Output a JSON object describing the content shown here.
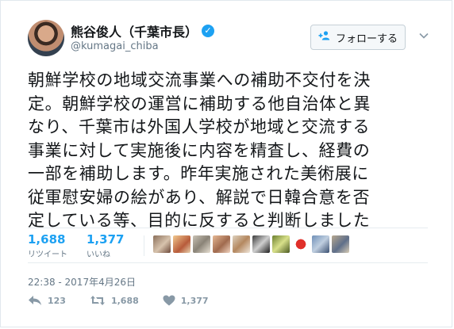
{
  "author": {
    "name": "熊谷俊人（千葉市長）",
    "handle": "@kumagai_chiba"
  },
  "follow_button": {
    "label": "フォローする",
    "icon": "add-user-icon"
  },
  "tweet": {
    "lines": [
      "朝鮮学校の地域交流事業への補助不交付を決",
      "定。朝鮮学校の運営に補助する他自治体と異",
      "なり、千葉市は外国人学校が地域と交流する",
      "事業に対して実施後に内容を精査し、経費の",
      "一部を補助します。昨年実施された美術展に",
      "従軍慰安婦の絵があり、解説で日韓合意を否",
      "定している等、目的に反すると判断しました"
    ]
  },
  "stats": {
    "retweets": {
      "count": "1,688",
      "label": "リツイート"
    },
    "likes": {
      "count": "1,377",
      "label": "いいね"
    }
  },
  "timestamp": "22:38 - 2017年4月26日",
  "actions": {
    "reply": {
      "count": "123",
      "icon": "reply-icon"
    },
    "retweet": {
      "count": "1,688",
      "icon": "retweet-icon"
    },
    "like": {
      "count": "1,377",
      "icon": "heart-icon"
    }
  },
  "colors": {
    "accent": "#1da1f2",
    "secondary_text": "#657786",
    "icon_gray": "#8899a6",
    "divider": "#e6ecf0"
  }
}
